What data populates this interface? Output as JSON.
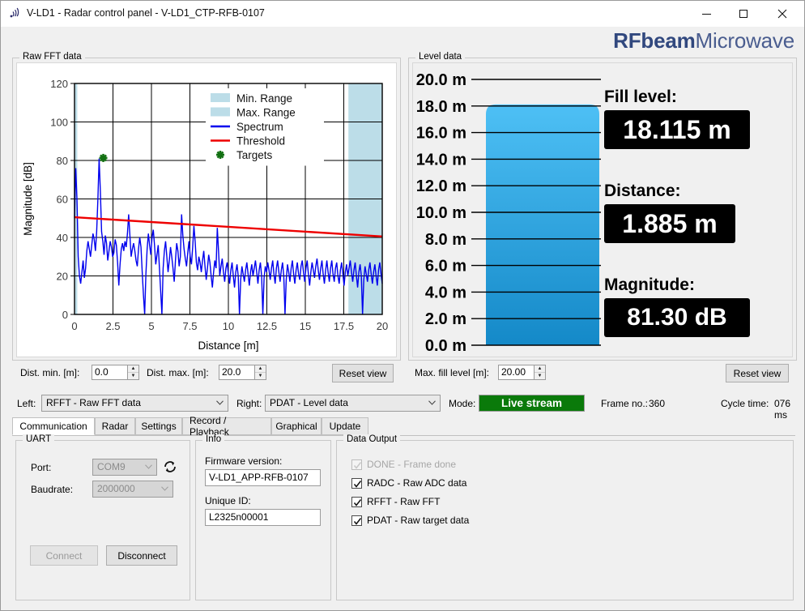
{
  "window": {
    "title": "V-LD1 - Radar control panel - V-LD1_CTP-RFB-0107",
    "app_icon": "signal-waves-icon",
    "minimize": "–",
    "maximize": "□",
    "close": "✕"
  },
  "logo": {
    "bold": "RFbeam",
    "light": "Microwave"
  },
  "panels": {
    "fft_title": "Raw FFT data",
    "level_title": "Level data"
  },
  "chart_data": [
    {
      "type": "line",
      "name": "raw-fft-spectrum",
      "title": "Raw FFT data",
      "xlabel": "Distance [m]",
      "ylabel": "Magnitude [dB]",
      "xlim": [
        0,
        20
      ],
      "ylim": [
        0,
        120
      ],
      "xticks": [
        0,
        2.5,
        5,
        7.5,
        10,
        12.5,
        15,
        17.5,
        20
      ],
      "xtick_labels": [
        "0",
        "2.5",
        "5",
        "7.5",
        "10",
        "12.5",
        "15",
        "17.5",
        "20"
      ],
      "yticks": [
        0,
        20,
        40,
        60,
        80,
        100,
        120
      ],
      "ytick_labels": [
        "0",
        "20",
        "40",
        "60",
        "80",
        "100",
        "120"
      ],
      "grid": true,
      "legend_position": "top-right",
      "legend": [
        {
          "label": "Min. Range",
          "type": "band",
          "color": "#bcdde8"
        },
        {
          "label": "Max. Range",
          "type": "band",
          "color": "#bcdde8"
        },
        {
          "label": "Spectrum",
          "type": "line",
          "color": "#0000ee"
        },
        {
          "label": "Threshold",
          "type": "line",
          "color": "#ee0000"
        },
        {
          "label": "Targets",
          "type": "marker",
          "color": "#127012"
        }
      ],
      "min_range_band": [
        0.0,
        0.18
      ],
      "max_range_band": [
        17.8,
        20.0
      ],
      "threshold": {
        "color": "#ee0000",
        "x": [
          0,
          20
        ],
        "y": [
          50.5,
          40.5
        ]
      },
      "targets": [
        {
          "x": 1.87,
          "y": 81.3,
          "marker": "star",
          "color": "#127012"
        }
      ],
      "series": [
        {
          "name": "Spectrum",
          "color": "#0000ee",
          "x": [
            0.0,
            0.08,
            0.16,
            0.24,
            0.32,
            0.4,
            0.48,
            0.56,
            0.64,
            0.72,
            0.8,
            0.88,
            0.96,
            1.04,
            1.12,
            1.2,
            1.28,
            1.36,
            1.44,
            1.52,
            1.6,
            1.68,
            1.76,
            1.84,
            1.92,
            2.0,
            2.08,
            2.16,
            2.24,
            2.32,
            2.4,
            2.48,
            2.56,
            2.64,
            2.72,
            2.8,
            2.88,
            2.96,
            3.04,
            3.12,
            3.2,
            3.28,
            3.36,
            3.44,
            3.52,
            3.6,
            3.68,
            3.76,
            3.84,
            3.92,
            4.0,
            4.08,
            4.16,
            4.24,
            4.32,
            4.4,
            4.48,
            4.56,
            4.64,
            4.72,
            4.8,
            4.88,
            4.96,
            5.04,
            5.12,
            5.2,
            5.28,
            5.36,
            5.44,
            5.52,
            5.6,
            5.68,
            5.76,
            5.84,
            5.92,
            6.0,
            6.08,
            6.16,
            6.24,
            6.32,
            6.4,
            6.48,
            6.56,
            6.64,
            6.72,
            6.8,
            6.88,
            6.96,
            7.04,
            7.12,
            7.2,
            7.28,
            7.36,
            7.44,
            7.52,
            7.6,
            7.68,
            7.76,
            7.84,
            7.92,
            8.0,
            8.08,
            8.16,
            8.24,
            8.32,
            8.4,
            8.48,
            8.56,
            8.64,
            8.72,
            8.8,
            8.88,
            8.96,
            9.04,
            9.12,
            9.2,
            9.28,
            9.36,
            9.44,
            9.52,
            9.6,
            9.68,
            9.76,
            9.84,
            9.92,
            10.0,
            10.08,
            10.16,
            10.24,
            10.32,
            10.4,
            10.48,
            10.56,
            10.64,
            10.72,
            10.8,
            10.88,
            10.96,
            11.04,
            11.12,
            11.2,
            11.28,
            11.36,
            11.44,
            11.52,
            11.6,
            11.68,
            11.76,
            11.84,
            11.92,
            12.0,
            12.08,
            12.16,
            12.24,
            12.32,
            12.4,
            12.48,
            12.56,
            12.64,
            12.72,
            12.8,
            12.88,
            12.96,
            13.04,
            13.12,
            13.2,
            13.28,
            13.36,
            13.44,
            13.52,
            13.6,
            13.68,
            13.76,
            13.84,
            13.92,
            14.0,
            14.08,
            14.16,
            14.24,
            14.32,
            14.4,
            14.48,
            14.56,
            14.64,
            14.72,
            14.8,
            14.88,
            14.96,
            15.04,
            15.12,
            15.2,
            15.28,
            15.36,
            15.44,
            15.52,
            15.6,
            15.68,
            15.76,
            15.84,
            15.92,
            16.0,
            16.08,
            16.16,
            16.24,
            16.32,
            16.4,
            16.48,
            16.56,
            16.64,
            16.72,
            16.8,
            16.88,
            16.96,
            17.04,
            17.12,
            17.2,
            17.28,
            17.36,
            17.44,
            17.52,
            17.6,
            17.68,
            17.76,
            17.84,
            17.92,
            18.0,
            18.08,
            18.16,
            18.24,
            18.32,
            18.4,
            18.48,
            18.56,
            18.64,
            18.72,
            18.8,
            18.88,
            18.96,
            19.04,
            19.12,
            19.2,
            19.28,
            19.36,
            19.44,
            19.52,
            19.6,
            19.68,
            19.76,
            19.84,
            19.92,
            20.0
          ],
          "y": [
            50,
            76,
            60,
            30,
            20,
            16,
            22,
            28,
            19,
            24,
            33,
            38,
            34,
            30,
            36,
            42,
            39,
            33,
            43,
            60,
            81,
            64,
            43,
            38,
            31,
            41,
            37,
            28,
            33,
            38,
            35,
            30,
            32,
            39,
            36,
            27,
            15,
            26,
            34,
            37,
            33,
            38,
            35,
            42,
            52,
            41,
            30,
            34,
            37,
            33,
            28,
            25,
            34,
            40,
            35,
            22,
            10,
            0,
            21,
            34,
            42,
            36,
            31,
            40,
            44,
            36,
            26,
            31,
            36,
            24,
            12,
            0,
            24,
            33,
            38,
            30,
            22,
            28,
            35,
            30,
            24,
            17,
            28,
            37,
            33,
            25,
            30,
            52,
            41,
            34,
            29,
            25,
            32,
            38,
            30,
            26,
            35,
            46,
            38,
            27,
            23,
            30,
            27,
            22,
            28,
            33,
            25,
            18,
            24,
            31,
            27,
            20,
            14,
            22,
            28,
            24,
            45,
            33,
            20,
            25,
            29,
            22,
            17,
            24,
            27,
            21,
            16,
            23,
            27,
            20,
            14,
            22,
            26,
            20,
            0,
            18,
            25,
            21,
            17,
            23,
            27,
            21,
            15,
            22,
            26,
            20,
            24,
            28,
            22,
            16,
            23,
            27,
            20,
            0,
            19,
            25,
            22,
            27,
            23,
            18,
            24,
            28,
            21,
            16,
            24,
            28,
            22,
            17,
            23,
            27,
            20,
            0,
            18,
            26,
            22,
            17,
            24,
            28,
            21,
            16,
            23,
            27,
            21,
            18,
            25,
            28,
            22,
            17,
            24,
            28,
            21,
            15,
            22,
            27,
            23,
            19,
            25,
            29,
            23,
            18,
            24,
            28,
            21,
            16,
            23,
            28,
            22,
            17,
            24,
            28,
            21,
            17,
            24,
            27,
            20,
            16,
            23,
            27,
            21,
            15,
            22,
            26,
            20,
            24,
            28,
            22,
            17,
            23,
            27,
            20,
            14,
            22,
            26,
            20,
            0,
            18,
            25,
            21,
            17,
            23,
            27,
            21,
            16,
            22,
            26,
            20,
            15,
            23,
            27,
            21,
            16,
            22,
            30,
            24
          ]
        }
      ]
    },
    {
      "type": "bar",
      "name": "level-tank-gauge",
      "title": "Level data",
      "orientation": "vertical",
      "unit": "m",
      "ylim": [
        0,
        20
      ],
      "yticks": [
        0.0,
        2.0,
        4.0,
        6.0,
        8.0,
        10.0,
        12.0,
        14.0,
        16.0,
        18.0,
        20.0
      ],
      "ytick_labels": [
        "0.0 m",
        "2.0 m",
        "4.0 m",
        "6.0 m",
        "8.0 m",
        "10.0 m",
        "12.0 m",
        "14.0 m",
        "16.0 m",
        "18.0 m",
        "20.0 m"
      ],
      "fill_value": 18.115,
      "fill_color_top": "#4ec0f5",
      "fill_color_bottom": "#1489c8"
    }
  ],
  "readouts": [
    {
      "label": "Fill level:",
      "value": "18.115 m"
    },
    {
      "label": "Distance:",
      "value": "1.885 m"
    },
    {
      "label": "Magnitude:",
      "value": "81.30 dB"
    }
  ],
  "fft_controls": {
    "dist_min_label": "Dist. min. [m]:",
    "dist_min_value": "0.0",
    "dist_max_label": "Dist. max. [m]:",
    "dist_max_value": "20.0",
    "reset_view": "Reset view"
  },
  "level_controls": {
    "max_fill_label": "Max. fill level [m]:",
    "max_fill_value": "20.00",
    "reset_view": "Reset view"
  },
  "status_bar": {
    "left_label": "Left:",
    "left_value": "RFFT - Raw FFT data",
    "right_label": "Right:",
    "right_value": "PDAT - Level data",
    "mode_label": "Mode:",
    "mode_value": "Live stream",
    "frame_label": "Frame no.:",
    "frame_value": "360",
    "cycle_label": "Cycle time:",
    "cycle_value": "076 ms"
  },
  "tabs": [
    {
      "label": "Communication",
      "active": true
    },
    {
      "label": "Radar",
      "active": false
    },
    {
      "label": "Settings",
      "active": false
    },
    {
      "label": "Record / Playback",
      "active": false
    },
    {
      "label": "Graphical",
      "active": false
    },
    {
      "label": "Update",
      "active": false
    }
  ],
  "uart": {
    "title": "UART",
    "port_label": "Port:",
    "port_value": "COM9",
    "baudrate_label": "Baudrate:",
    "baudrate_value": "2000000",
    "refresh_icon": "refresh-icon",
    "connect": "Connect",
    "disconnect": "Disconnect"
  },
  "info": {
    "title": "Info",
    "firmware_label": "Firmware version:",
    "firmware_value": "V-LD1_APP-RFB-0107",
    "uid_label": "Unique ID:",
    "uid_value": "L2325n00001"
  },
  "data_output": {
    "title": "Data Output",
    "items": [
      {
        "label": "DONE - Frame done",
        "checked": true,
        "enabled": false
      },
      {
        "label": "RADC - Raw ADC data",
        "checked": true,
        "enabled": true
      },
      {
        "label": "RFFT - Raw FFT",
        "checked": true,
        "enabled": true
      },
      {
        "label": "PDAT - Raw target data",
        "checked": true,
        "enabled": true
      }
    ]
  }
}
